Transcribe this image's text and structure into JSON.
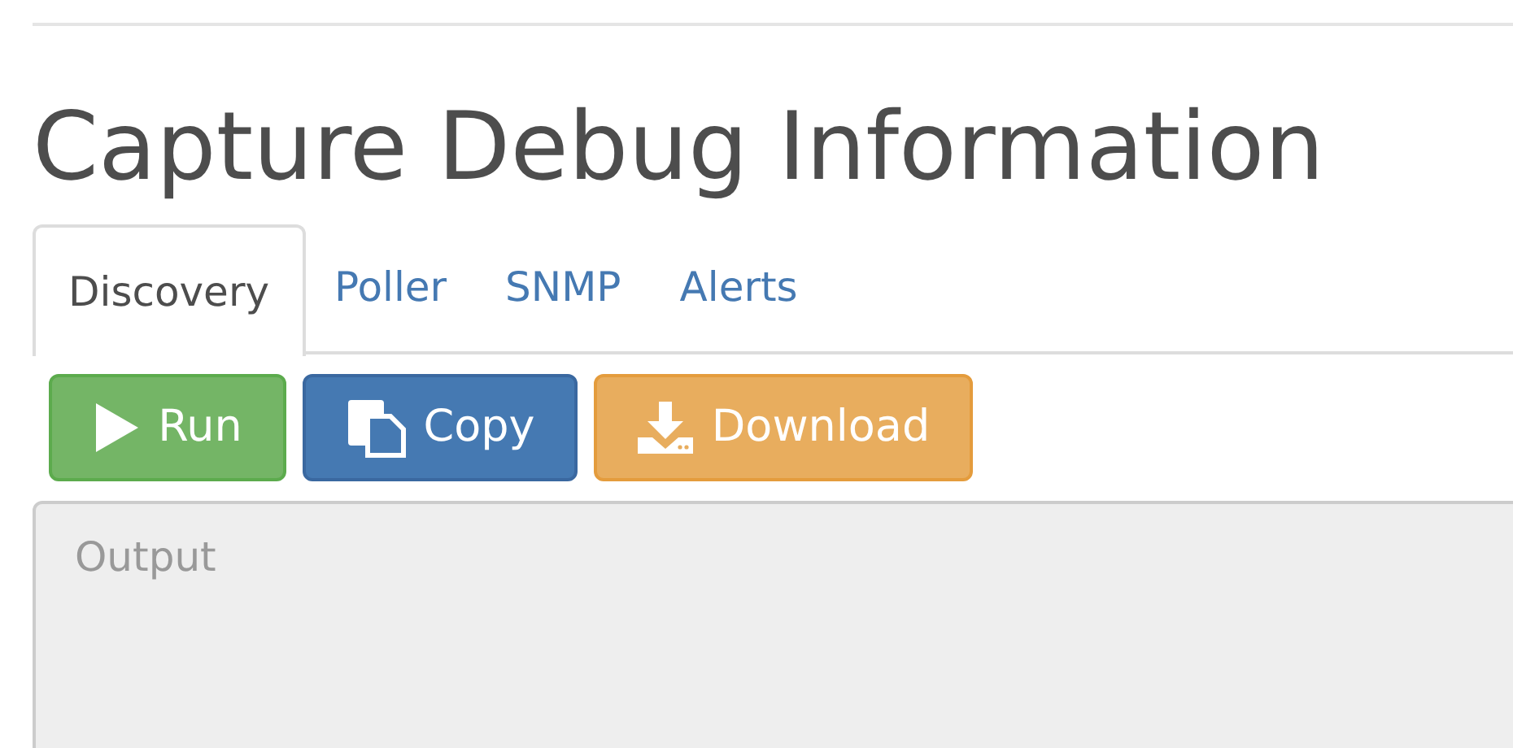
{
  "title": "Capture Debug Information",
  "tabs": [
    {
      "label": "Discovery",
      "selected": true
    },
    {
      "label": "Poller",
      "selected": false
    },
    {
      "label": "SNMP",
      "selected": false
    },
    {
      "label": "Alerts",
      "selected": false
    }
  ],
  "buttons": [
    {
      "kind": "run",
      "label": "Run"
    },
    {
      "kind": "copy",
      "label": "Copy"
    },
    {
      "kind": "download",
      "label": "Download"
    }
  ],
  "output": {
    "placeholder": "Output",
    "disabled": true
  }
}
